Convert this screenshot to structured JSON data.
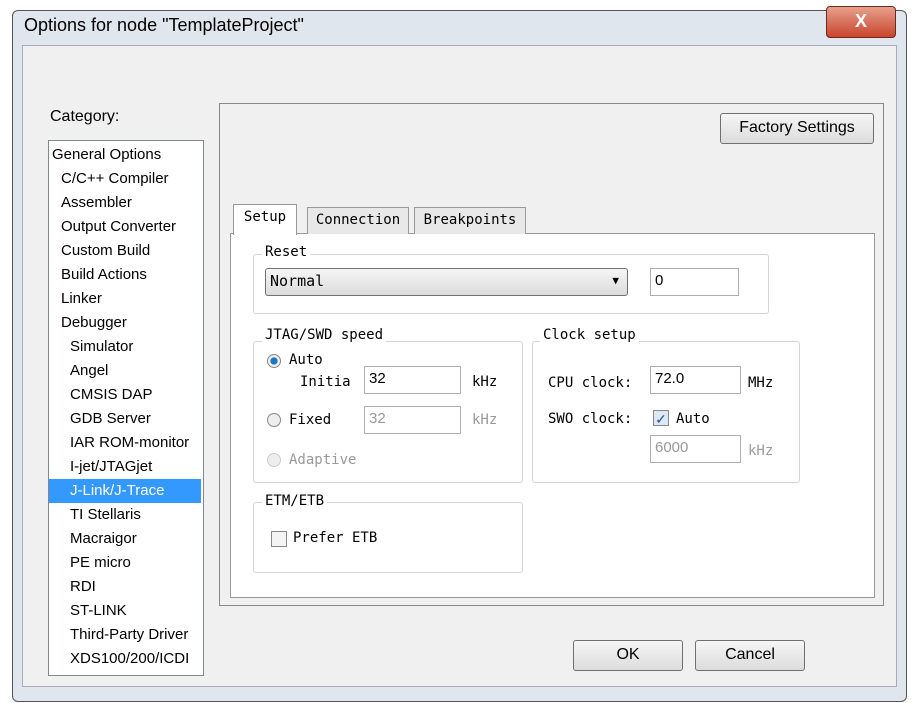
{
  "window": {
    "title": "Options for node \"TemplateProject\"",
    "close": "X"
  },
  "category": {
    "label": "Category:",
    "items": [
      "General Options",
      "C/C++ Compiler",
      "Assembler",
      "Output Converter",
      "Custom Build",
      "Build Actions",
      "Linker",
      "Debugger",
      "Simulator",
      "Angel",
      "CMSIS DAP",
      "GDB Server",
      "IAR ROM-monitor",
      "I-jet/JTAGjet",
      "J-Link/J-Trace",
      "TI Stellaris",
      "Macraigor",
      "PE micro",
      "RDI",
      "ST-LINK",
      "Third-Party Driver",
      "XDS100/200/ICDI"
    ],
    "selected": "J-Link/J-Trace"
  },
  "factory_settings": "Factory Settings",
  "tabs": [
    "Setup",
    "Connection",
    "Breakpoints"
  ],
  "reset": {
    "label": "Reset",
    "mode": "Normal",
    "delay": "0"
  },
  "jtag": {
    "label": "JTAG/SWD speed",
    "auto": "Auto",
    "initial": "Initia",
    "initial_value": "32",
    "fixed": "Fixed",
    "fixed_value": "32",
    "adaptive": "Adaptive",
    "unit": "kHz",
    "selected": "Auto"
  },
  "clock": {
    "label": "Clock setup",
    "cpu_label": "CPU clock:",
    "cpu_value": "72.0",
    "cpu_unit": "MHz",
    "swo_label": "SWO clock:",
    "swo_auto": "Auto",
    "swo_auto_checked": true,
    "swo_value": "6000",
    "swo_unit": "kHz"
  },
  "etm": {
    "label": "ETM/ETB",
    "prefer": "Prefer ETB",
    "checked": false
  },
  "buttons": {
    "ok": "OK",
    "cancel": "Cancel"
  }
}
